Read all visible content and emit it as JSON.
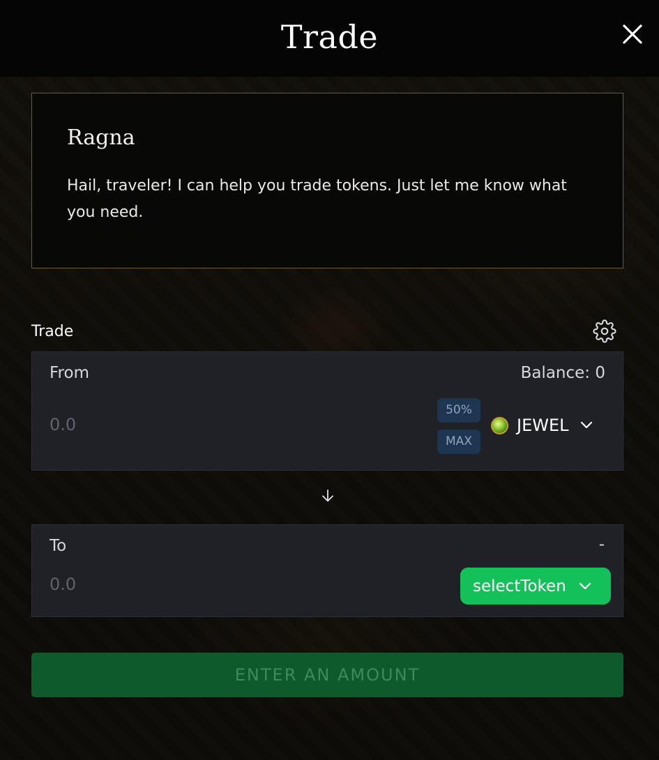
{
  "header": {
    "title": "Trade"
  },
  "npc": {
    "name": "Ragna",
    "message": "Hail, traveler! I can help you trade tokens. Just let me know what you need."
  },
  "trade": {
    "label": "Trade",
    "from": {
      "label": "From",
      "balance": "Balance: 0",
      "amount_placeholder": "0.0",
      "pct_50_label": "50%",
      "max_label": "MAX",
      "token": {
        "name": "JEWEL",
        "icon": "jewel-token-icon"
      }
    },
    "to": {
      "label": "To",
      "balance": "-",
      "amount_placeholder": "0.0",
      "select_label": "selectToken"
    },
    "submit_label": "ENTER AN AMOUNT"
  },
  "colors": {
    "accent_green": "#14c059",
    "submit_disabled": "#0f5a2c",
    "panel_bg": "#1f2127",
    "pct_button_bg": "#1f3653",
    "npc_border": "#6b5a36"
  }
}
